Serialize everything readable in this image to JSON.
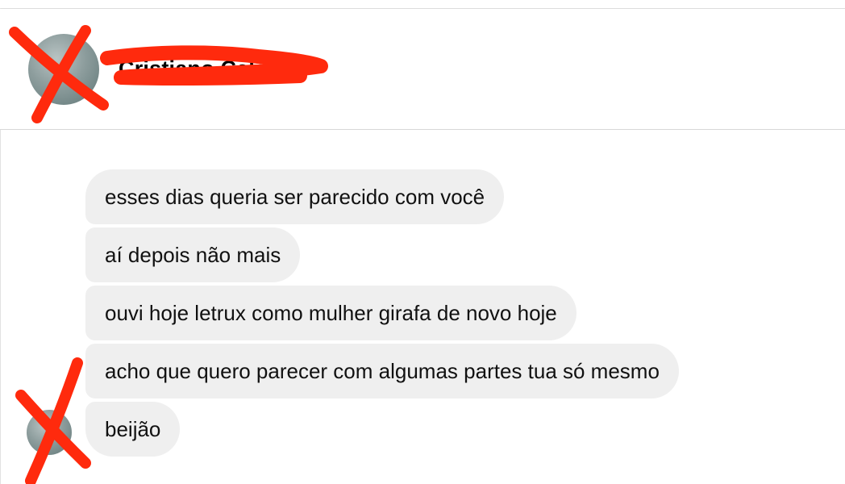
{
  "header": {
    "contact_name": "Cristiano Caldas"
  },
  "messages": [
    {
      "text": "esses dias queria ser parecido com você"
    },
    {
      "text": "aí depois não mais"
    },
    {
      "text": "ouvi hoje letrux como mulher girafa de novo hoje"
    },
    {
      "text": "acho que quero parecer com algumas partes tua só mesmo"
    },
    {
      "text": "beijão"
    }
  ],
  "colors": {
    "bubble_background": "#efefef",
    "redaction_mark": "#ff2a0d",
    "divider": "#d8d8d8"
  },
  "icons": {
    "header_avatar": "avatar",
    "message_avatar": "avatar"
  }
}
